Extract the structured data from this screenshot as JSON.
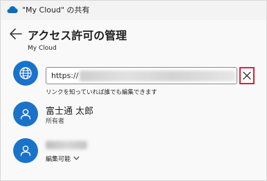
{
  "window": {
    "title": "\"My Cloud\" の共有",
    "icon": "onedrive-cloud-icon"
  },
  "header": {
    "back_icon": "arrow-left-icon",
    "title": "アクセス許可の管理",
    "subtitle": "My Cloud"
  },
  "share_link": {
    "icon": "globe-icon",
    "value_prefix": "https://",
    "value_obscured": true,
    "clear_icon": "close-icon",
    "hint": "リンクを知っていれば誰でも編集できます"
  },
  "members": [
    {
      "avatar_icon": "person-icon",
      "name": "富士通 太郎",
      "role": "所有者",
      "name_obscured": false
    },
    {
      "avatar_icon": "person-icon",
      "name_obscured": true,
      "permission": "編集可能",
      "permission_icon": "chevron-down-icon"
    }
  ],
  "colors": {
    "accent": "#1a73c9",
    "highlight_border": "#d9232d",
    "background": "#f9f9f9",
    "titlebar": "#f3f3f3"
  }
}
